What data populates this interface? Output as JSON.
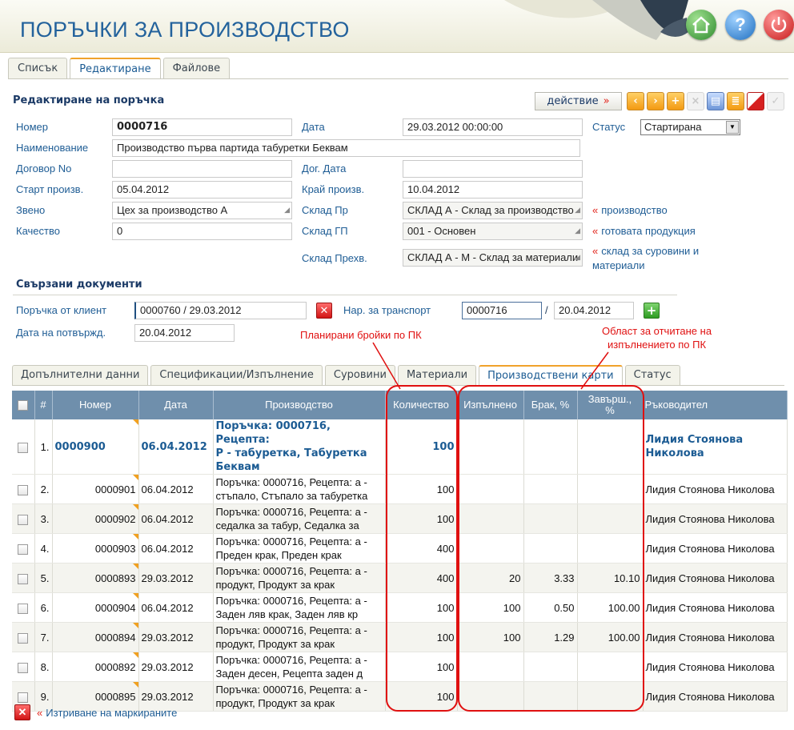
{
  "app": {
    "title": "ПОРЪЧКИ ЗА ПРОИЗВОДСТВО",
    "help_label": "?"
  },
  "top_tabs": [
    "Списък",
    "Редактиране",
    "Файлове"
  ],
  "form": {
    "title": "Редактиране на поръчка",
    "action_label": "действие",
    "raquo": "»",
    "laquo": "«",
    "fields": {
      "nomer": {
        "label": "Номер",
        "value": "0000716"
      },
      "data": {
        "label": "Дата",
        "value": "29.03.2012 00:00:00"
      },
      "status": {
        "label": "Статус",
        "value": "Стартирана"
      },
      "naimenovanie": {
        "label": "Наименование",
        "value": "Производство първа партида табуретки Беквам"
      },
      "dogovor": {
        "label": "Договор No",
        "value": ""
      },
      "dog_data": {
        "label": "Дог. Дата",
        "value": ""
      },
      "start": {
        "label": "Старт произв.",
        "value": "05.04.2012"
      },
      "kraj": {
        "label": "Край произв.",
        "value": "10.04.2012"
      },
      "zveno": {
        "label": "Звено",
        "value": "Цех за производство А"
      },
      "sklad_pr": {
        "label": "Склад Пр",
        "value": "СКЛАД А - Склад за производство"
      },
      "kachestvo": {
        "label": "Качество",
        "value": "0"
      },
      "sklad_gp": {
        "label": "Склад ГП",
        "value": "001 - Основен"
      },
      "sklad_prehv": {
        "label": "Склад Прехв.",
        "value": "СКЛАД А - М - Склад за материали"
      }
    },
    "links": {
      "proizvodstvo": "производство",
      "gotova": "готовата продукция",
      "surovini_1": "склад за суровини и",
      "surovini_2": "материали"
    }
  },
  "related": {
    "title": "Свързани документи",
    "order_client_label": "Поръчка от клиент",
    "order_client_value": "0000760 / 29.03.2012",
    "transport_label": "Нар. за транспорт",
    "transport_number": "0000716",
    "transport_sep": "/",
    "transport_date": "20.04.2012",
    "confirm_label": "Дата на потвържд.",
    "confirm_value": "20.04.2012"
  },
  "annotations": {
    "planned": "Планирани бройки по ПК",
    "area_1": "Област за отчитане на",
    "area_2": "изпълнението по ПК"
  },
  "sub_tabs": [
    "Допълнителни данни",
    "Спецификации/Изпълнение",
    "Суровини",
    "Материали",
    "Производствени карти",
    "Статус"
  ],
  "table": {
    "headers": {
      "num": "#",
      "nomer": "Номер",
      "data": "Дата",
      "proizvodstvo": "Производство",
      "kolichestvo": "Количество",
      "izpalneno": "Изпълнено",
      "brak": "Брак, %",
      "zavarsh_1": "Завърш.,",
      "zavarsh_2": "%",
      "rakovoditel": "Ръководител"
    },
    "rows": [
      {
        "n": "1.",
        "nomer": "0000900",
        "data": "06.04.2012",
        "prod_1": "Поръчка: 0000716, Рецепта:",
        "prod_2": "Р - табуретка, Табуретка",
        "prod_3": "Беквам",
        "kol": "100",
        "izp": "",
        "brak": "",
        "zav": "",
        "rak_1": "Лидия Стоянова",
        "rak_2": "Николова"
      },
      {
        "n": "2.",
        "nomer": "0000901",
        "data": "06.04.2012",
        "prod_1": "Поръчка: 0000716, Рецепта: а -",
        "prod_2": "стъпало, Стъпало за табуретка",
        "kol": "100",
        "izp": "",
        "brak": "",
        "zav": "",
        "rak": "Лидия Стоянова Николова"
      },
      {
        "n": "3.",
        "nomer": "0000902",
        "data": "06.04.2012",
        "prod_1": "Поръчка: 0000716, Рецепта: а -",
        "prod_2": "седалка за табур, Седалка за",
        "kol": "100",
        "izp": "",
        "brak": "",
        "zav": "",
        "rak": "Лидия Стоянова Николова"
      },
      {
        "n": "4.",
        "nomer": "0000903",
        "data": "06.04.2012",
        "prod_1": "Поръчка: 0000716, Рецепта: а -",
        "prod_2": "Преден крак, Преден крак",
        "kol": "400",
        "izp": "",
        "brak": "",
        "zav": "",
        "rak": "Лидия Стоянова Николова"
      },
      {
        "n": "5.",
        "nomer": "0000893",
        "data": "29.03.2012",
        "prod_1": "Поръчка: 0000716, Рецепта: а -",
        "prod_2": "продукт, Продукт за крак",
        "kol": "400",
        "izp": "20",
        "brak": "3.33",
        "zav": "10.10",
        "rak": "Лидия Стоянова Николова"
      },
      {
        "n": "6.",
        "nomer": "0000904",
        "data": "06.04.2012",
        "prod_1": "Поръчка: 0000716, Рецепта: а -",
        "prod_2": "Заден ляв крак, Заден ляв кр",
        "kol": "100",
        "izp": "100",
        "brak": "0.50",
        "zav": "100.00",
        "rak": "Лидия Стоянова Николова"
      },
      {
        "n": "7.",
        "nomer": "0000894",
        "data": "29.03.2012",
        "prod_1": "Поръчка: 0000716, Рецепта: а -",
        "prod_2": "продукт, Продукт за крак",
        "kol": "100",
        "izp": "100",
        "brak": "1.29",
        "zav": "100.00",
        "rak": "Лидия Стоянова Николова"
      },
      {
        "n": "8.",
        "nomer": "0000892",
        "data": "29.03.2012",
        "prod_1": "Поръчка: 0000716, Рецепта: а -",
        "prod_2": "Заден десен, Рецепта заден д",
        "kol": "100",
        "izp": "",
        "brak": "",
        "zav": "",
        "rak": "Лидия Стоянова Николова"
      },
      {
        "n": "9.",
        "nomer": "0000895",
        "data": "29.03.2012",
        "prod_1": "Поръчка: 0000716, Рецепта: а -",
        "prod_2": "продукт, Продукт за крак",
        "kol": "100",
        "izp": "",
        "brak": "",
        "zav": "",
        "rak": "Лидия Стоянова Николова"
      }
    ]
  },
  "footer": {
    "delete_marked": "Изтриване на маркираните"
  },
  "colors": {
    "accent": "#f0a22b",
    "title": "#23629c",
    "header_row": "#6f8fac",
    "annotation": "#e01010"
  }
}
